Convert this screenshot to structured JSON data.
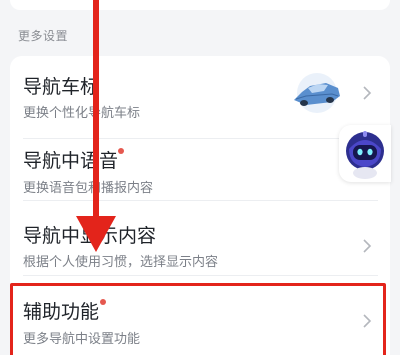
{
  "section": {
    "title": "更多设置"
  },
  "rows": [
    {
      "title": "导航车标",
      "subtitle": "更换个性化导航车标"
    },
    {
      "title": "导航中语音",
      "subtitle": "更换语音包和播报内容"
    },
    {
      "title": "导航中显示内容",
      "subtitle": "根据个人使用习惯，选择显示内容"
    },
    {
      "title": "辅助功能",
      "subtitle": "更多导航中设置功能"
    }
  ],
  "colors": {
    "accent_red": "#e3241b",
    "dot": "#e5584f",
    "text": "#1f2329",
    "subtext": "#7c8088"
  },
  "icons": [
    "car-mark-icon",
    "robot-assistant-icon",
    "chevron-right-icon"
  ]
}
